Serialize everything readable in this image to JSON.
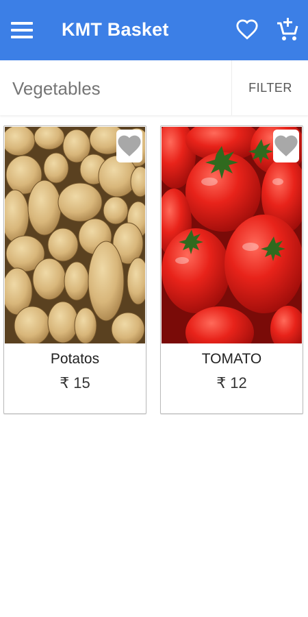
{
  "app": {
    "title": "KMT Basket"
  },
  "colors": {
    "app_bar": "#3c7fe6",
    "icon_fill": "#ffffff",
    "heart_grey": "#a8a8a8"
  },
  "icons": {
    "menu": "menu-icon",
    "favorites": "heart-outline-icon",
    "cart": "add-to-cart-icon",
    "product_favorite": "heart-icon"
  },
  "section": {
    "title": "Vegetables",
    "filter_label": "FILTER"
  },
  "products": [
    {
      "name": "Potatos",
      "currency": "₹",
      "price": "15",
      "image": "potatoes"
    },
    {
      "name": "TOMATO",
      "currency": "₹",
      "price": "12",
      "image": "tomatoes"
    }
  ]
}
